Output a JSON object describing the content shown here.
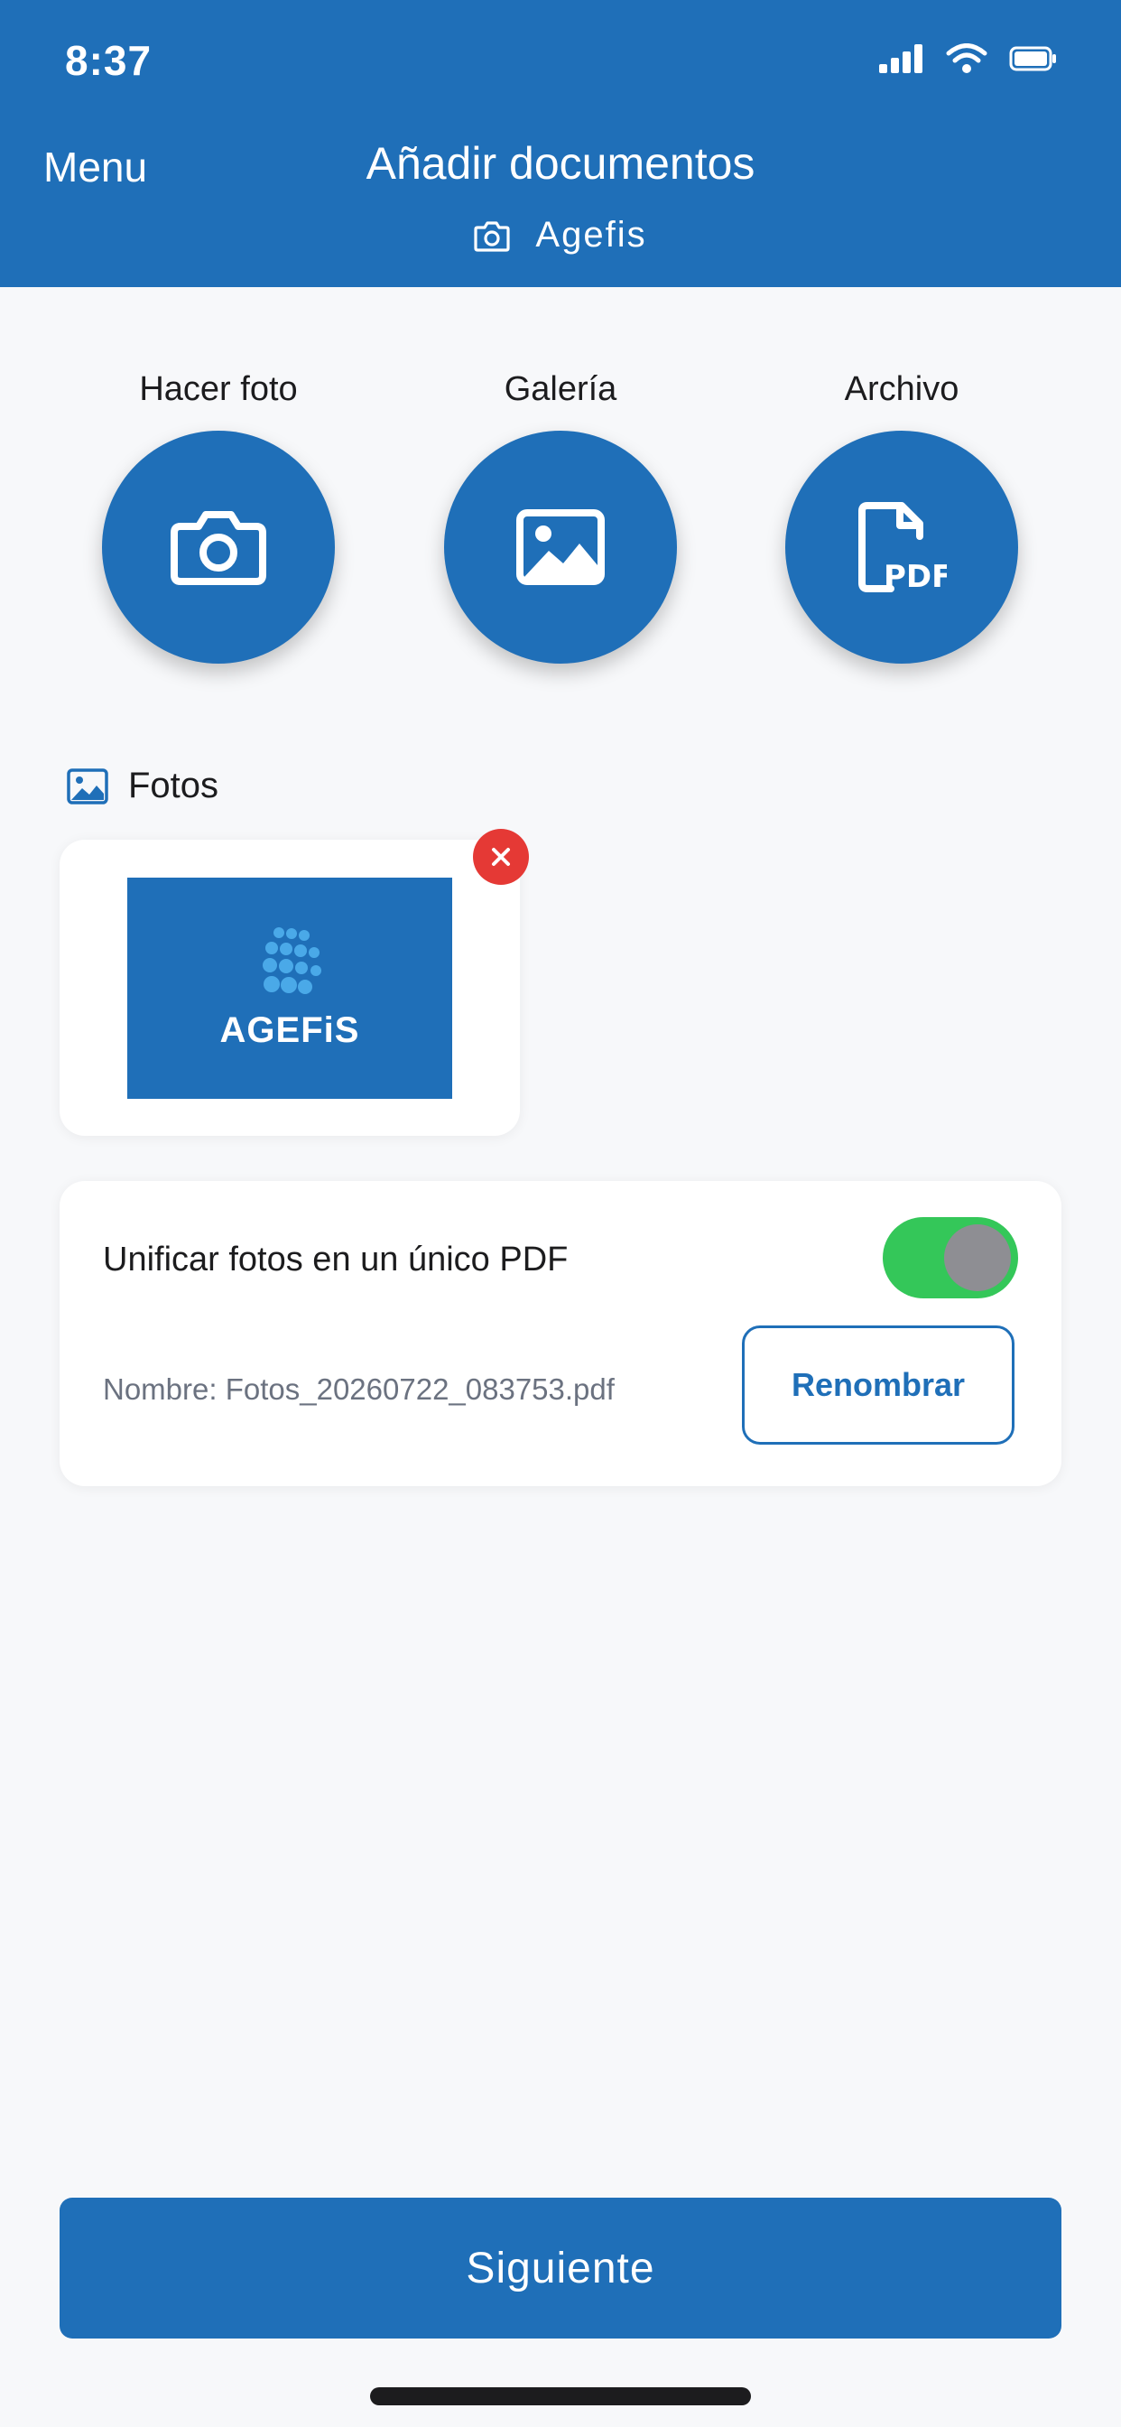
{
  "status_bar": {
    "time": "8:37",
    "icons": [
      "signal-icon",
      "wifi-icon",
      "battery-icon"
    ]
  },
  "header": {
    "menu_label": "Menu",
    "title": "Añadir documentos",
    "subtitle": "Agefis",
    "subtitle_icon": "camera-icon"
  },
  "actions": [
    {
      "label": "Hacer foto",
      "icon": "camera-icon"
    },
    {
      "label": "Galería",
      "icon": "image-icon"
    },
    {
      "label": "Archivo",
      "icon": "pdf-file-icon"
    }
  ],
  "photos_section": {
    "title": "Fotos",
    "icon": "image-icon",
    "items": [
      {
        "logo_text": "AGEFiS",
        "remove_icon": "close-icon"
      }
    ]
  },
  "merge": {
    "label": "Unificar fotos en un único PDF",
    "enabled": true,
    "filename": "Nombre: Fotos_20260722_083753.pdf",
    "rename_label": "Renombrar"
  },
  "footer": {
    "next_label": "Siguiente"
  },
  "colors": {
    "primary": "#1f6fb8",
    "toggle_on": "#34c759",
    "remove": "#e53935",
    "background": "#f7f8fa"
  }
}
